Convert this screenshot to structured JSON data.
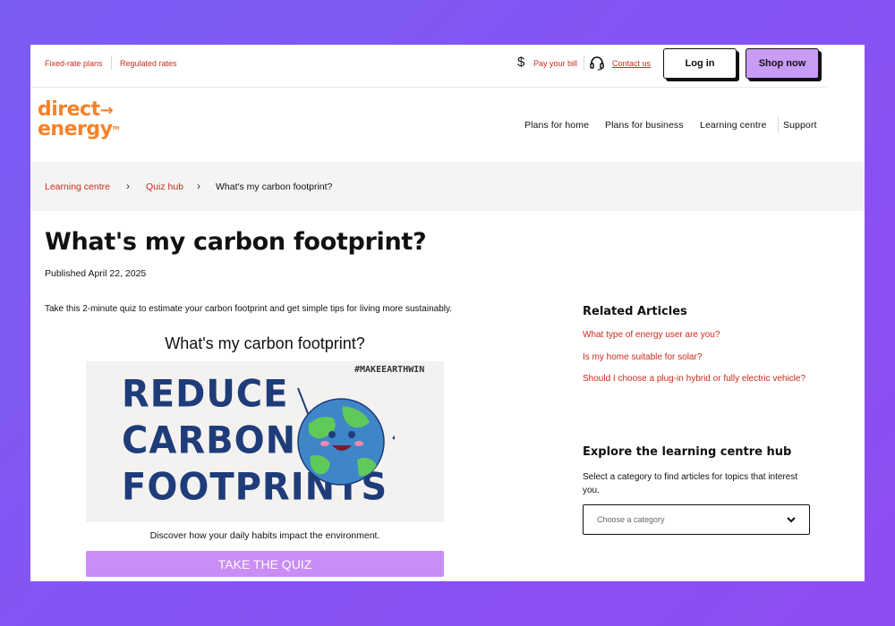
{
  "utility": {
    "links": [
      "Fixed-rate plans",
      "Regulated rates"
    ],
    "pay_bill": "Pay your bill",
    "contact": "Contact us",
    "login": "Log in",
    "shop": "Shop now"
  },
  "logo": {
    "line1": "direct",
    "line2": "energy",
    "tm": "TM"
  },
  "nav": [
    "Plans for home",
    "Plans for business",
    "Learning centre",
    "Support"
  ],
  "breadcrumb": [
    "Learning centre",
    "Quiz hub",
    "What's my carbon footprint?"
  ],
  "article": {
    "title": "What's my carbon footprint?",
    "published": "Published April 22, 2025",
    "intro": "Take this 2-minute quiz to estimate your carbon footprint and get simple tips for living more sustainably."
  },
  "quiz": {
    "title": "What's my carbon footprint?",
    "image_words": [
      "REDUCE",
      "CARBON",
      "FOOTPRINTS"
    ],
    "hashtag": "#MAKEEARTHWIN",
    "caption": "Discover how your daily habits impact the environment.",
    "button": "TAKE THE QUIZ"
  },
  "sidebar": {
    "related_heading": "Related Articles",
    "related": [
      "What type of energy user are you?",
      "Is my home suitable for solar?",
      "Should I choose a plug-in hybrid or fully electric vehicle?"
    ],
    "hub_heading": "Explore the learning centre hub",
    "hub_desc": "Select a category to find articles for topics that interest you.",
    "select_placeholder": "Choose a category"
  },
  "colors": {
    "accent": "#cc2a1b",
    "brand": "#f5822a",
    "button": "#c89bf5",
    "quiz_button": "#c98df5"
  },
  "icons": [
    "dollar-icon",
    "headset-icon",
    "arrow-right-icon",
    "chevron-right-icon",
    "chevron-down-icon"
  ]
}
